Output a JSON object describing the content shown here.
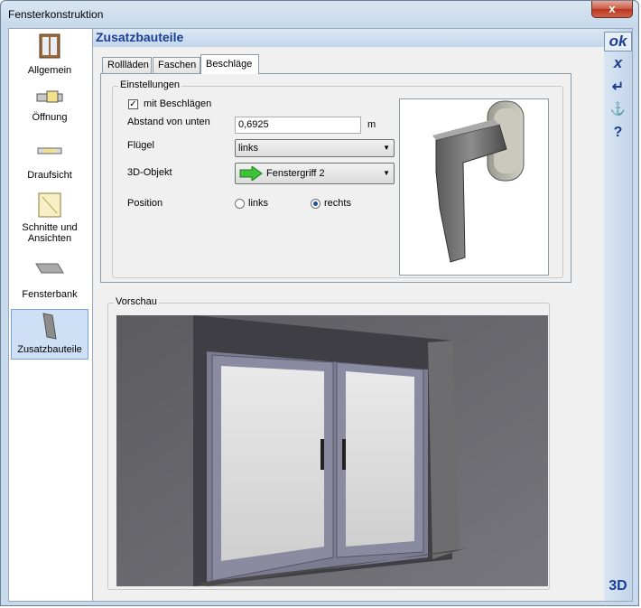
{
  "window": {
    "title": "Fensterkonstruktion",
    "close": "x"
  },
  "sidebar": {
    "items": [
      {
        "label": "Allgemein"
      },
      {
        "label": "Öffnung"
      },
      {
        "label": "Draufsicht"
      },
      {
        "label": "Schnitte und Ansichten"
      },
      {
        "label": "Fensterbank"
      },
      {
        "label": "Zusatzbauteile"
      }
    ]
  },
  "panel": {
    "title": "Zusatzbauteile"
  },
  "tabs": [
    {
      "label": "Rollläden"
    },
    {
      "label": "Faschen"
    },
    {
      "label": "Beschläge"
    }
  ],
  "settings": {
    "group_label": "Einstellungen",
    "checkbox_label": "mit Beschlägen",
    "checkbox_mark": "✓",
    "distance_label": "Abstand von unten",
    "distance_value": "0,6925",
    "distance_unit": "m",
    "wing_label": "Flügel",
    "wing_value": "links",
    "object_label": "3D-Objekt",
    "object_value": "Fenstergriff 2",
    "position_label": "Position",
    "position_left": "links",
    "position_right": "rechts"
  },
  "preview": {
    "group_label": "Vorschau"
  },
  "toolbar": {
    "ok": "ok",
    "cancel": "x",
    "enter": "↵",
    "stamp": "⚓",
    "help": "?",
    "view3d": "3D"
  }
}
